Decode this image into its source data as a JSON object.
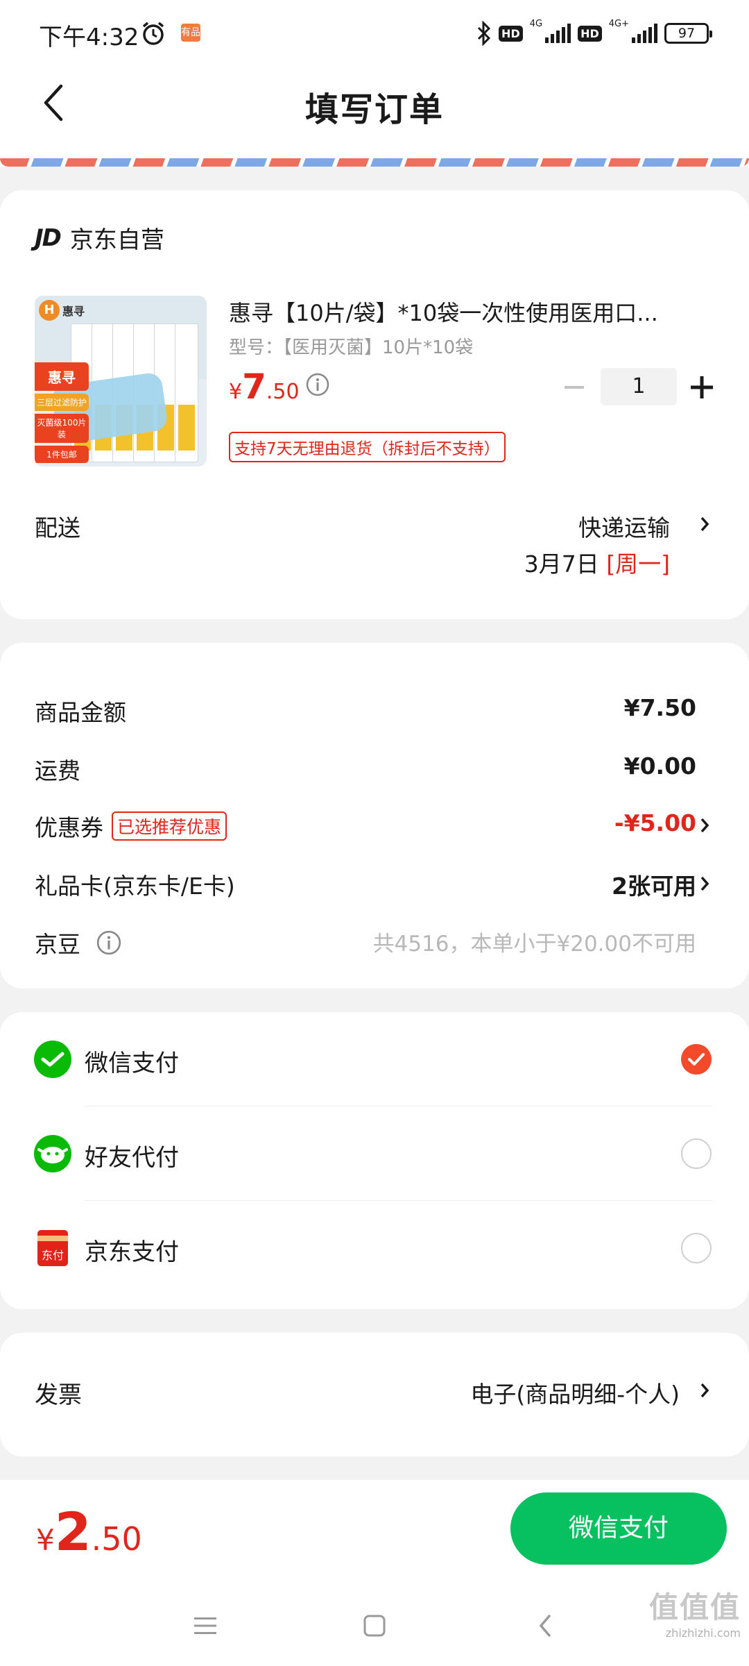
{
  "status_bar": {
    "time": "下午4:32",
    "app_badge": "有品",
    "net1": "4G",
    "net2": "4G+",
    "hd": "HD",
    "battery": "97"
  },
  "nav": {
    "title": "填写订单"
  },
  "shop": {
    "logo": "JD",
    "name": "京东自营"
  },
  "product": {
    "image": {
      "logo_text": "惠寻",
      "tags": [
        "惠寻",
        "三层过滤防护",
        "灭菌级100片装",
        "1件包邮"
      ]
    },
    "title": "惠寻【10片/袋】*10袋一次性使用医用口...",
    "spec": "型号：【医用灭菌】10片*10袋",
    "price_currency": "¥",
    "price_int": "7",
    "price_dec": ".50",
    "quantity": "1",
    "return_policy": "支持7天无理由退货（拆封后不支持）"
  },
  "shipping": {
    "label": "配送",
    "method": "快递运输",
    "date": "3月7日 ",
    "weekday": "[周一]"
  },
  "amounts": {
    "goods": {
      "label": "商品金额",
      "value": "¥7.50"
    },
    "freight": {
      "label": "运费",
      "value": "¥0.00"
    },
    "coupon": {
      "label": "优惠券",
      "tag": "已选推荐优惠",
      "value": "-¥5.00"
    },
    "gift_card": {
      "label": "礼品卡(京东卡/E卡)",
      "value": "2张可用"
    },
    "beans": {
      "label": "京豆",
      "value": "共4516，本单小于¥20.00不可用"
    }
  },
  "payment": {
    "options": [
      {
        "label": "微信支付",
        "selected": true
      },
      {
        "label": "好友代付",
        "selected": false
      },
      {
        "label": "京东支付",
        "selected": false
      }
    ],
    "jd_pay_icon_text": "东付"
  },
  "invoice": {
    "label": "发票",
    "value": "电子(商品明细-个人)"
  },
  "bottom": {
    "currency": "¥",
    "total_int": "2",
    "total_dec": ".50",
    "pay_button": "微信支付"
  },
  "watermark": {
    "glyphs": "值值值",
    "url": "zhizhizhi.com"
  },
  "colors": {
    "accent_red": "#e1251b",
    "wechat_green": "#07c160",
    "radio_selected": "#f24a2a"
  }
}
